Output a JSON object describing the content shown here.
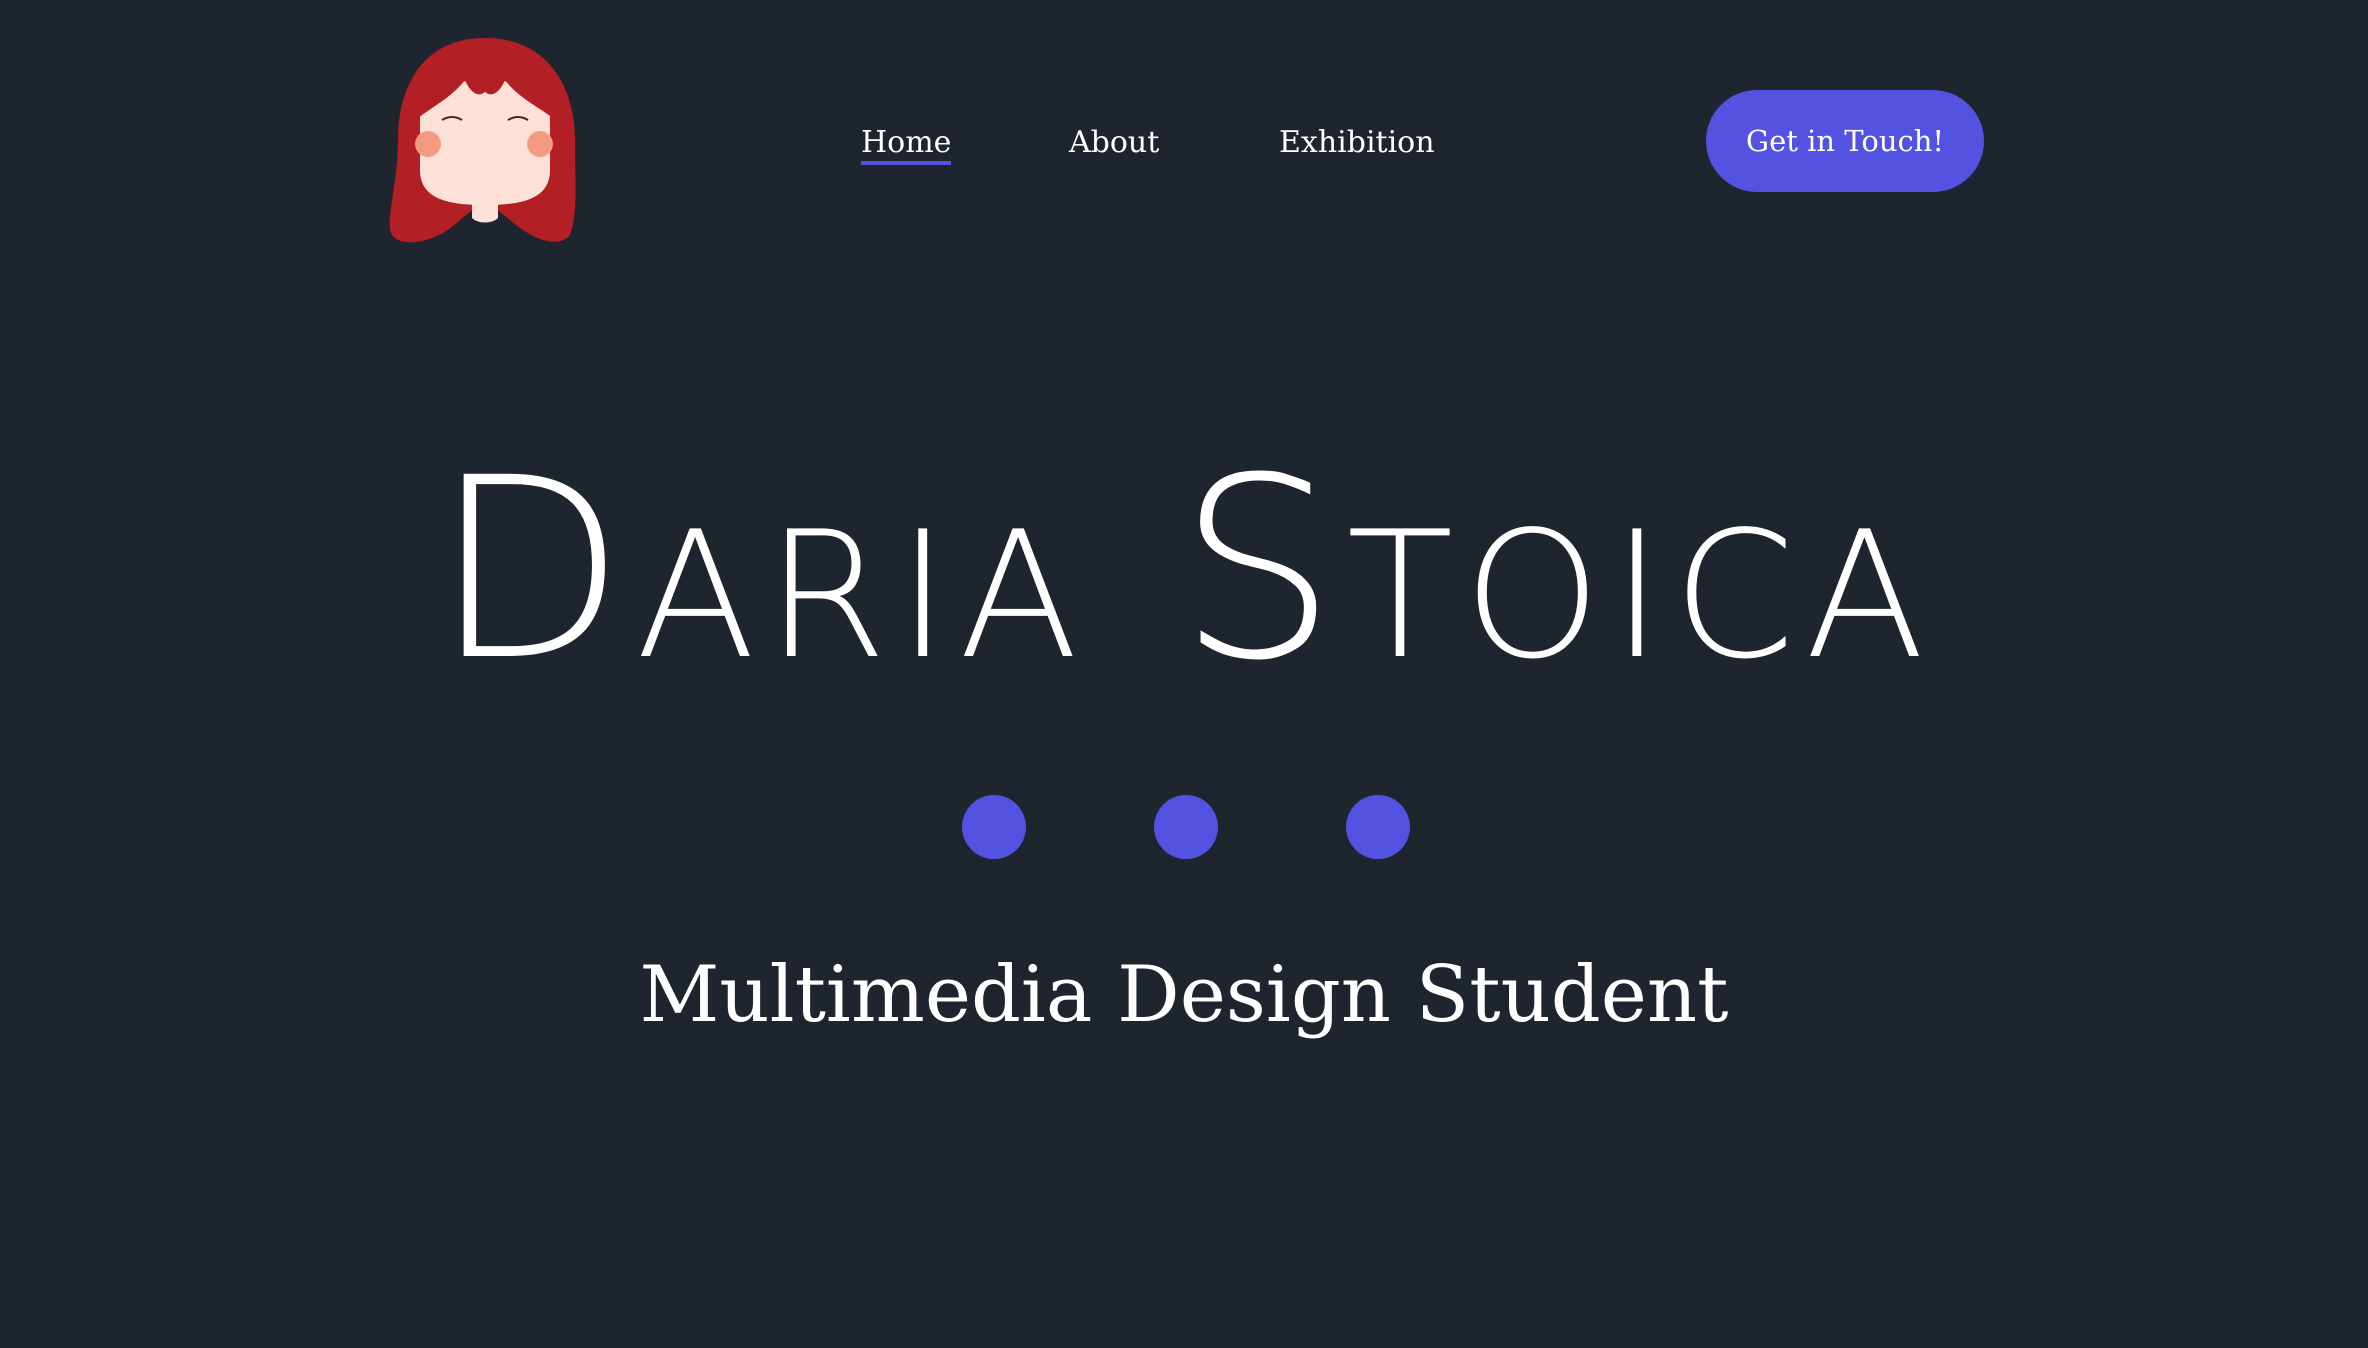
{
  "header": {
    "nav": {
      "home": "Home",
      "about": "About",
      "exhibition": "Exhibition"
    },
    "cta_label": "Get in Touch!"
  },
  "hero": {
    "title": "Daria Stoica",
    "subtitle": "Multimedia Design Student",
    "dots_count": 3
  },
  "colors": {
    "background": "#1e252e",
    "accent": "#5352e1",
    "hair": "#b21f24",
    "skin": "#fde1d6",
    "cheeks": "#f49a80"
  },
  "icons": {
    "avatar": "red-haired-girl-avatar-icon"
  }
}
